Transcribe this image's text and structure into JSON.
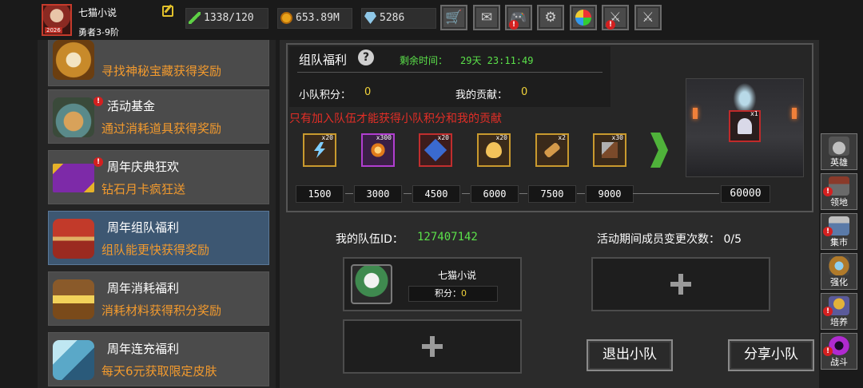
{
  "player": {
    "name": "七猫小说",
    "rank": "勇者3-9阶",
    "avatar_badge": "2026"
  },
  "resources": {
    "energy": "1338/120",
    "gold": "653.89M",
    "gems": "5286"
  },
  "top_buttons": [
    "shop-cart-icon",
    "mail-icon",
    "gamepad-icon",
    "settings-gear-icon",
    "color-wheel-icon",
    "broken-sword-icon",
    "crossed-swords-icon"
  ],
  "event_list": [
    {
      "title": "",
      "subtitle": "寻找神秘宝藏获得奖励",
      "icon": "treasure-medal-icon",
      "alert": false,
      "selected": false
    },
    {
      "title": "活动基金",
      "subtitle": "通过消耗道具获得奖励",
      "icon": "money-bag-icon",
      "alert": true,
      "selected": false
    },
    {
      "title": "周年庆典狂欢",
      "subtitle": "钻石月卡疯狂送",
      "icon": "diamond-card-icon",
      "alert": true,
      "selected": false
    },
    {
      "title": "周年组队福利",
      "subtitle": "组队能更快获得奖励",
      "icon": "team-chest-icon",
      "alert": false,
      "selected": true
    },
    {
      "title": "周年消耗福利",
      "subtitle": "消耗材料获得积分奖励",
      "icon": "open-chest-icon",
      "alert": false,
      "selected": false
    },
    {
      "title": "周年连充福利",
      "subtitle": "每天6元获取限定皮肤",
      "icon": "crystal-icon",
      "alert": false,
      "selected": false
    }
  ],
  "team_welfare": {
    "title": "组队福利",
    "help_glyph": "?",
    "time_label": "剩余时间：",
    "time_value": "29天 23:11:49",
    "team_score_label": "小队积分：",
    "team_score": "0",
    "my_contrib_label": "我的贡献：",
    "my_contrib": "0",
    "tip": "只有加入队伍才能获得小队积分和我的贡献",
    "rewards": [
      {
        "count": "x20",
        "icon": "lightning-icon",
        "rarity": "gold"
      },
      {
        "count": "x300",
        "icon": "flame-shard-icon",
        "rarity": "purple"
      },
      {
        "count": "x20",
        "icon": "blue-gem-icon",
        "rarity": "red"
      },
      {
        "count": "x20",
        "icon": "golden-egg-icon",
        "rarity": "gold"
      },
      {
        "count": "x2",
        "icon": "scroll-icon",
        "rarity": "gold"
      },
      {
        "count": "x30",
        "icon": "hammer-icon",
        "rarity": "gold"
      }
    ],
    "milestones": [
      "1500",
      "3000",
      "4500",
      "6000",
      "7500",
      "9000"
    ],
    "final_milestone": "60000",
    "grand_reward": {
      "count": "x1",
      "icon": "angel-relic-icon"
    }
  },
  "team": {
    "id_label": "我的队伍ID：",
    "id_value": "127407142",
    "changes_label": "活动期间成员变更次数：",
    "changes_value": "0/5",
    "member": {
      "name": "七猫小说",
      "score_label": "积分：",
      "score": "0"
    },
    "leave_button": "退出小队",
    "share_button": "分享小队"
  },
  "side_nav": [
    {
      "label": "英雄",
      "alert": false,
      "icon": "helmet-icon"
    },
    {
      "label": "领地",
      "alert": true,
      "icon": "castle-icon"
    },
    {
      "label": "集市",
      "alert": true,
      "icon": "market-icon"
    },
    {
      "label": "强化",
      "alert": false,
      "icon": "forge-icon"
    },
    {
      "label": "培养",
      "alert": true,
      "icon": "trophy-icon"
    },
    {
      "label": "战斗",
      "alert": true,
      "icon": "portal-icon"
    }
  ],
  "colors": {
    "accent_orange": "#f29a2e",
    "green": "#5be14a",
    "yellow": "#f1d33a",
    "alert_red": "#e32e26",
    "selected_blue": "#3d5772"
  }
}
